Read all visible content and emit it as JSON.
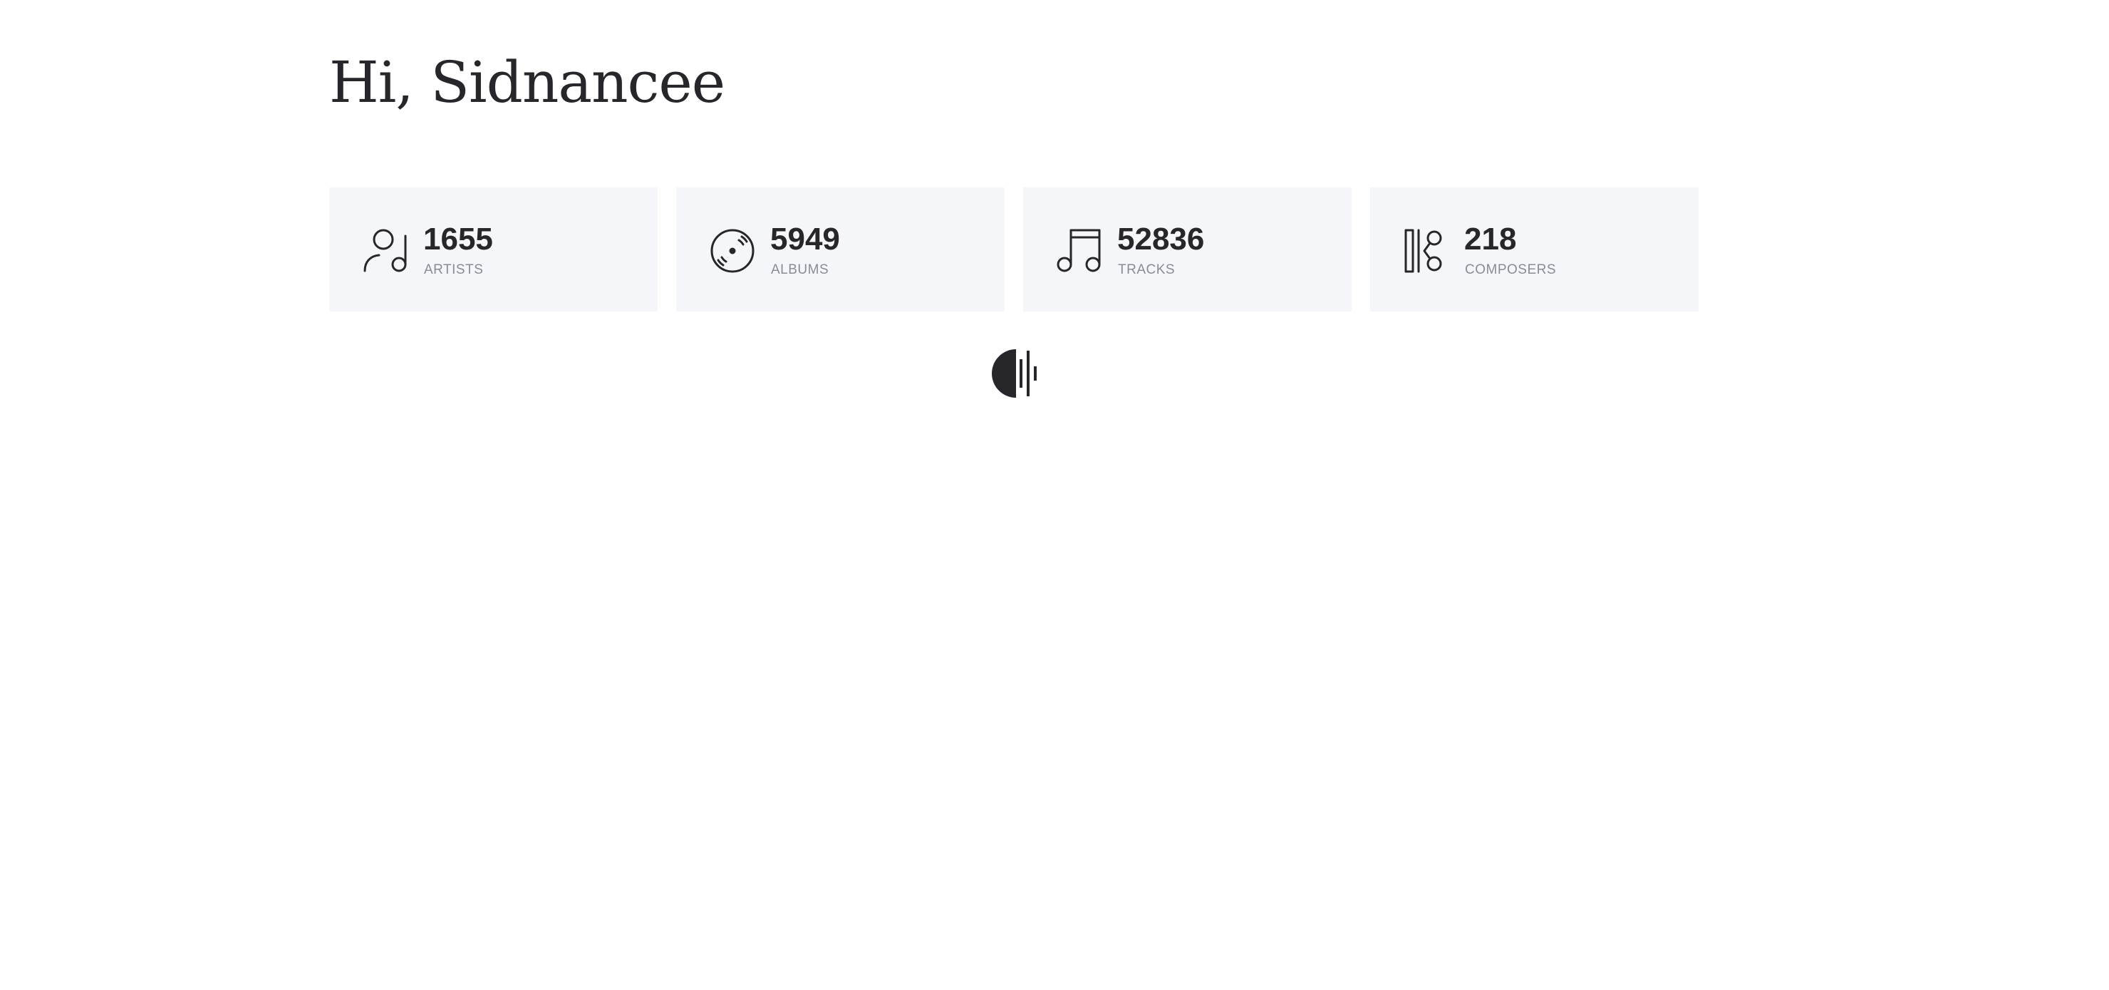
{
  "header": {
    "greeting": "Hi, Sidnancee"
  },
  "stats": [
    {
      "icon": "artist-music-icon",
      "count": "1655",
      "label": "ARTISTS"
    },
    {
      "icon": "vinyl-disc-icon",
      "count": "5949",
      "label": "ALBUMS"
    },
    {
      "icon": "music-note-icon",
      "count": "52836",
      "label": "TRACKS"
    },
    {
      "icon": "composer-icon",
      "count": "218",
      "label": "COMPOSERS"
    }
  ],
  "loader": {
    "icon": "loading-logo-icon"
  },
  "colors": {
    "text": "#26262b",
    "muted": "#8a8c93",
    "card_bg": "#f5f6f9",
    "page_bg": "#ffffff"
  }
}
